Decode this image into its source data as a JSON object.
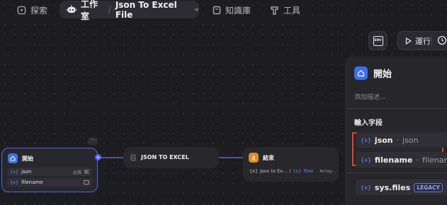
{
  "nav": {
    "explore": "探索",
    "studio": "工作室",
    "separator": "/",
    "app_name": "Json To Excel File",
    "knowledge": "知識庫",
    "tools": "工具"
  },
  "toolbar": {
    "env_label": "ENV",
    "run_label": "運行"
  },
  "nodes": {
    "start": {
      "title": "開始",
      "fields": [
        {
          "name": "json",
          "badge": "必填"
        },
        {
          "name": "filename",
          "badge": ""
        }
      ],
      "more": "···"
    },
    "json_to_excel": {
      "title": "JSON TO EXCEL"
    },
    "end": {
      "title": "結束",
      "output": "Json to Ex...",
      "separator": "/",
      "var": "files",
      "type": "Array..."
    }
  },
  "panel": {
    "title": "開始",
    "desc_placeholder": "添加描述...",
    "section_title": "輸入字段",
    "fields": [
      {
        "name": "json",
        "type": "json"
      },
      {
        "name": "filename",
        "type": "filename"
      }
    ],
    "sys_field": "sys.files",
    "legacy_badge": "LEGACY"
  },
  "colors": {
    "accent": "#5566dd",
    "highlight_border": "#e0462f",
    "var_blue": "#6c8cff",
    "end_icon": "#e08a2c",
    "start_icon": "#3d6df0"
  }
}
